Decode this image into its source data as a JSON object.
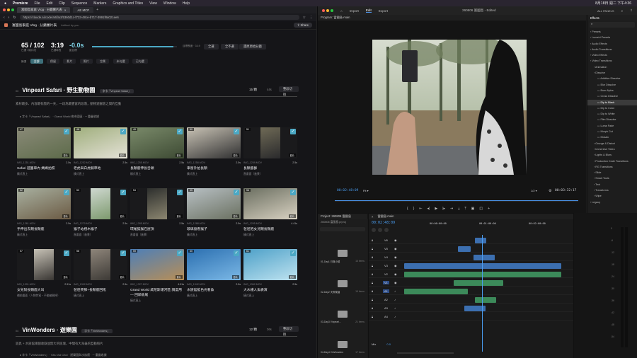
{
  "menubar": {
    "items": [
      "Premiere",
      "File",
      "Edit",
      "Clip",
      "Sequence",
      "Markers",
      "Graphics and Titles",
      "View",
      "Window",
      "Help"
    ],
    "clock": "8月18日 週二 下午4:36"
  },
  "browser": {
    "tabs": [
      "富國島家庭 Vlog · 分鏡審片表",
      "AE MCP"
    ],
    "url": "https://claude.ai/code/artifact/5360d1c-f733-48ce-b717-3991f8a021ee6",
    "app_title": "富國島家庭 Vlog · 分鏡審片表",
    "app_subtitle": "Artifact by you",
    "share_label": "Share",
    "stats": {
      "selected": "65 / 102",
      "selected_label": "已選 / 總片段",
      "duration": "3:19",
      "duration_label": "已選時長",
      "diff": "-0.0s",
      "diff_label": "距目標",
      "target_label": "目標長度 · 3:19",
      "btn_all": "全選",
      "btn_none": "全不選",
      "btn_reset": "還原原始分鏡",
      "progress": 0.96
    },
    "filters": [
      "全部",
      "保留",
      "影片",
      "照片",
      "空景",
      "未勾選",
      "已勾選"
    ],
    "filter_label": "篩選",
    "sections": [
      {
        "num": "03",
        "title": "Vinpearl Safari · 野生動物園",
        "tag": "字卡「Vinpearl Safari」",
        "count": "15 顆",
        "dur": "44s",
        "btn": "整段切換",
        "desc": "素材最多、內容最有戲的一天，一段為最豐富的段落，動物遊園客之間的互動",
        "sub": "▸ 字卡「Vinpearl Safari」 · Grand World 夜市園區 · ─ 重疊收據"
      },
      {
        "num": "04",
        "title": "VinWonders · 遊樂園",
        "tag": "字卡「VinWonders」",
        "count": "12 顆",
        "dur": "36s",
        "btn": "整段切換",
        "desc": "遊具 + 水族館兩個收錄並無大的區塊，中間有大海龜的互動照片",
        "sub": "▸ 字卡「VinWonders」 · Khu Vui Choi · 遊樂園與水族館 · ─ 重疊收據"
      }
    ],
    "cards": [
      {
        "num": "47",
        "file": "IMG_1251.MOV",
        "dur": "2.5s",
        "title": "Safari 遊園車內 媽媽拍照",
        "note": "橫式直上",
        "mark": "影片"
      },
      {
        "num": "48",
        "file": "IMG_1252.MOV",
        "dur": "2.5s",
        "title": "老虎與白虎躺草地",
        "note": "橫式直上",
        "mark": "影片"
      },
      {
        "num": "49",
        "file": "IMG_1255.MOV",
        "dur": "2.5s",
        "title": "長頸鹿伸長舌頭",
        "note": "橫式直上",
        "mark": "影片"
      },
      {
        "num": "50",
        "file": "IMG_1258.MOV",
        "dur": "2.5s",
        "title": "車窗外拍長頸",
        "note": "橫式直上",
        "mark": "影片"
      },
      {
        "num": "51",
        "file": "IMG_1259.MOV",
        "dur": "2.5s",
        "title": "長頸鹿群",
        "note": "直畫面（進景）",
        "mark": "影片"
      },
      {
        "num": "52",
        "file": "IMG_1261.MOV",
        "dur": "2.5s",
        "title": "手伸出去餵長頸鹿",
        "note": "橫式直上",
        "mark": "影片"
      },
      {
        "num": "53",
        "file": "IMG_1270.MOV",
        "dur": "2.5s",
        "title": "猴子站棧木猴子",
        "note": "直畫面（進景）",
        "mark": "影片"
      },
      {
        "num": "54",
        "file": "IMG_1285.MOV",
        "dur": "2.5s",
        "title": "環尾狐猴在屋頂",
        "note": "直畫面（進景）",
        "mark": "影片"
      },
      {
        "num": "55",
        "file": "IMG_1288.MOV",
        "dur": "2.5s",
        "title": "玻璃窗看猴子",
        "note": "橫式直上",
        "mark": "影片"
      },
      {
        "num": "56",
        "file": "IMG_1295.MOV",
        "dur": "4.41s",
        "title": "爸爸抱女兒餵長頸鹿",
        "note": "橫式直上",
        "mark": "影片"
      },
      {
        "num": "57",
        "file": "IMG_1301.MOV",
        "dur": "2.91s",
        "title": "女兒對長頸鹿大叫",
        "note": "補拍畫面（人物特寫・不能被刪掉）",
        "mark": "影片"
      },
      {
        "num": "58",
        "file": "IMG_1302.MOV",
        "dur": "2.5s",
        "title": "爸爸笑節+長頸鹿回吼",
        "note": "橫式直上",
        "mark": "影片"
      },
      {
        "num": "59",
        "file": "IMG_1327.MOV",
        "dur": "4.91s",
        "title": "Grand World 威尼斯運河區 調度用 — 回頭收尾",
        "note": "橫式直上",
        "mark": "影片"
      },
      {
        "num": "60",
        "file": "IMG_1342.MOV",
        "dur": "2.5s",
        "title": "水族館藍色光看魚",
        "note": "橫式直上",
        "mark": "影片"
      },
      {
        "num": "61",
        "file": "IMG_1362.MOV",
        "dur": "2.5s",
        "title": "大水槽人魚表演",
        "note": "橫式直上",
        "mark": "影片"
      }
    ]
  },
  "premiere": {
    "tabs": [
      "Import",
      "Edit",
      "Export"
    ],
    "doc_title": "260806 富國島 - Edited",
    "workspace": "ALL PANELS",
    "program_label": "Program: 富國島-main",
    "timecode_left": "00:02:48:09",
    "fit": "Fit",
    "quality": "1/2",
    "timecode_right": "00:03:32:17",
    "effects_tab": "Effects",
    "effects": [
      {
        "label": "Presets",
        "level": 0
      },
      {
        "label": "Lumetri Presets",
        "level": 0
      },
      {
        "label": "Audio Effects",
        "level": 0
      },
      {
        "label": "Audio Transitions",
        "level": 0
      },
      {
        "label": "Video Effects",
        "level": 0
      },
      {
        "label": "Video Transitions",
        "level": 0
      },
      {
        "label": "Animation",
        "level": 1
      },
      {
        "label": "Dissolve",
        "level": 1
      },
      {
        "label": "Additive Dissolve",
        "level": 2
      },
      {
        "label": "Blur Dissolve",
        "level": 2
      },
      {
        "label": "Burn Alpha",
        "level": 2
      },
      {
        "label": "Cross Dissolve",
        "level": 2
      },
      {
        "label": "Dip to Black",
        "level": 2,
        "selected": true
      },
      {
        "label": "Dip to Color",
        "level": 2
      },
      {
        "label": "Dip to White",
        "level": 2
      },
      {
        "label": "Film Dissolve",
        "level": 2
      },
      {
        "label": "Luma Fade",
        "level": 2
      },
      {
        "label": "Morph Cut",
        "level": 2
      },
      {
        "label": "Mosaic",
        "level": 2
      },
      {
        "label": "Grunge & Distort",
        "level": 1
      },
      {
        "label": "Immersive Video",
        "level": 1
      },
      {
        "label": "Lights & Blurs",
        "level": 1
      },
      {
        "label": "Production Crate Transitions",
        "level": 1
      },
      {
        "label": "RG Transitions",
        "level": 1
      },
      {
        "label": "Slide",
        "level": 1
      },
      {
        "label": "Smart Tools",
        "level": 1
      },
      {
        "label": "Text",
        "level": 1
      },
      {
        "label": "Transforms",
        "level": 1
      },
      {
        "label": "Wipe",
        "level": 1
      },
      {
        "label": "Legacy",
        "level": 0
      }
    ],
    "project_label": "Project: 260806 富國島",
    "project_file": "260806 富國島.prproj",
    "bins": [
      {
        "name": "01-Day1 日落小鎮",
        "count": "16 items"
      },
      {
        "name": "02-Day2 天際樂園",
        "count": "15 items"
      },
      {
        "name": "03-Day3 Vinpearl...",
        "count": "21 items"
      },
      {
        "name": "04-Day4 VinWonders",
        "count": "17 items"
      }
    ],
    "timeline_label": "富國島-main",
    "timeline_tc": "00:02:48:09",
    "ruler": [
      "00:00:00:00",
      "00:01:00:00",
      "00:02:00:00"
    ],
    "video_tracks": [
      "V6",
      "V5",
      "V4",
      "V3",
      "V2",
      "V1"
    ],
    "audio_tracks": [
      "A1",
      "A2",
      "A3",
      "A4"
    ],
    "mix_label": "Mix",
    "mix_value": "0.0",
    "meter_scale": [
      "0",
      "-6",
      "-12",
      "-18",
      "-24",
      "-30",
      "-36",
      "-42",
      "-48",
      "-54"
    ]
  }
}
